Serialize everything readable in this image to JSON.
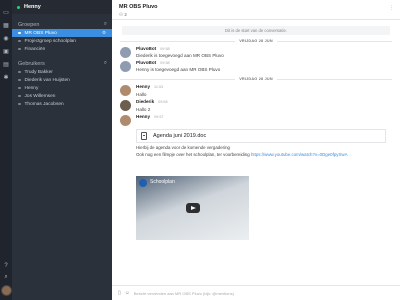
{
  "rail": {
    "icons": [
      "chat-icon",
      "grid-icon",
      "users-icon",
      "bell-icon",
      "folder-icon",
      "settings-icon"
    ],
    "bottom_icons": [
      "help-icon",
      "search-icon"
    ]
  },
  "sidebar": {
    "user_name": "Henny",
    "groups_title": "Groepen",
    "groups": [
      {
        "label": "MR OBS Pluvo",
        "active": true
      },
      {
        "label": "Projectgroep schoolplan"
      },
      {
        "label": "Financiën"
      }
    ],
    "users_title": "Gebruikers",
    "users": [
      {
        "label": "Trudy Bakker"
      },
      {
        "label": "Diederik van Huijsten"
      },
      {
        "label": "Henny"
      },
      {
        "label": "Jos Willemsen"
      },
      {
        "label": "Thomas Jacobsen"
      }
    ]
  },
  "main": {
    "title": "MR OBS Pluvo",
    "member_count": "2",
    "start_banner": "Dit is de start van de conversatie.",
    "day_separator": "VRIJDAG 28 JUN",
    "day_separator_2": "VRIJDAG 28 JUN",
    "messages": [
      {
        "author": "PluvoBot",
        "time": "09:58",
        "text": "Diederik is toegevoegd aan MR OBS Pluvo"
      },
      {
        "author": "PluvoBot",
        "time": "09:58",
        "text": "Henny is toegevoegd aan MR OBS Pluvo"
      },
      {
        "author": "Henny",
        "time": "11:53",
        "text": "Hallo"
      },
      {
        "author": "Diederik",
        "time": "09:58",
        "text": "Hallo 2"
      },
      {
        "author": "Henny",
        "time": "09:57",
        "text": ""
      }
    ],
    "attachment": {
      "name": "Agenda juni 2019.doc",
      "description": "Hierbij de agenda voor de komende vergadering",
      "link_text_prefix": "Ook nog een filmpje over het schoolplan, ter voorbereiding",
      "link_url": "https://www.youtube.com/watch?v=0Dge0fpyXwA"
    },
    "video_title": "Schoolplan"
  },
  "composer": {
    "placeholder": "Bericht verzenden aan MR OBS Pluvo (bijv. @mentions)"
  }
}
